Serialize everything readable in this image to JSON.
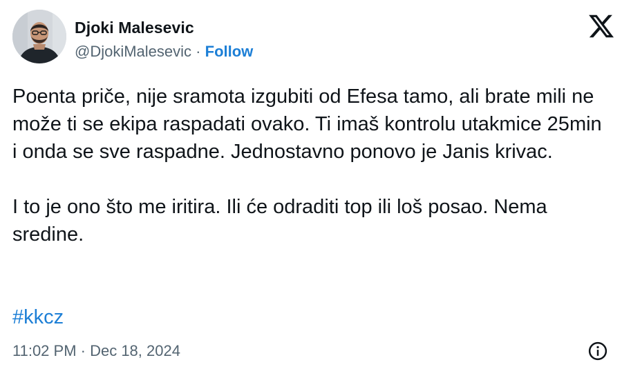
{
  "tweet": {
    "author": {
      "display_name": "Djoki Malesevic",
      "handle": "@DjokiMalesevic",
      "separator": "·",
      "follow_label": "Follow"
    },
    "platform_icon": "x-logo-icon",
    "paragraphs": [
      "Poenta priče, nije sramota izgubiti od Efesa tamo, ali brate mili ne može ti se ekipa raspadati ovako. Ti imaš kontrolu utakmice 25min i onda se sve raspadne. Jednostavno ponovo je Janis krivac.",
      "I to je ono što me iritira. Ili će odraditi top ili loš posao. Nema sredine."
    ],
    "hashtag": "#kkcz",
    "timestamp": "11:02 PM · Dec 18, 2024",
    "info_icon": "info-icon"
  },
  "colors": {
    "text": "#0f1419",
    "secondary": "#536471",
    "link": "#1d7fd6",
    "background": "#ffffff"
  }
}
